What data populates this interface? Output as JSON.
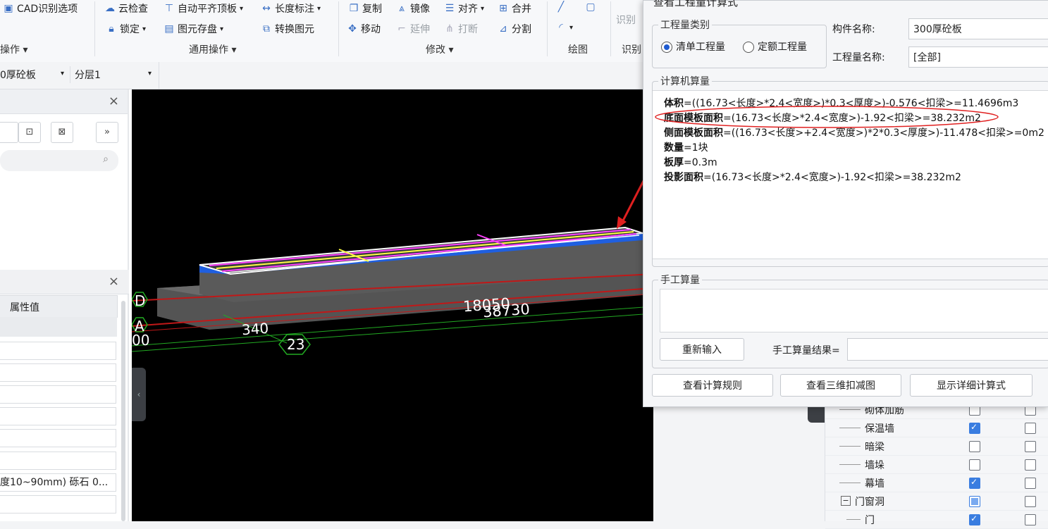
{
  "ribbon": {
    "cad_option": "CAD识别选项",
    "group_ops_partial": "操作",
    "cloud_check": "云检查",
    "auto_flat_top": "自动平齐顶板",
    "length_mark": "长度标注",
    "lock": "锁定",
    "element_save": "图元存盘",
    "convert_element": "转换图元",
    "group_general": "通用操作",
    "copy": "复制",
    "mirror": "镜像",
    "align": "对齐",
    "merge": "合并",
    "move": "移动",
    "extend": "延伸",
    "break": "打断",
    "split": "分割",
    "group_modify": "修改",
    "group_draw": "绘图",
    "identify_partial": "识别",
    "identify_partial2": "识别"
  },
  "subbar": {
    "component_select": "0厚砼板",
    "layer_select": "分层1"
  },
  "leftpanel": {
    "prop_header": "属性值",
    "row_text": "度10~90mm) 砾石 0..."
  },
  "viewport": {
    "dim_18050": "18050",
    "dim_38730": "38730",
    "dim_340": "340",
    "axis_23": "23",
    "axis_d": "D",
    "axis_a": "A",
    "dim_00": "00"
  },
  "dialog": {
    "title": "查看工程量计算式",
    "category_legend": "工程量类别",
    "radio_list": "清单工程量",
    "radio_quota": "定额工程量",
    "component_name_label": "构件名称:",
    "component_name_value": "300厚砼板",
    "quantity_name_label": "工程量名称:",
    "quantity_name_value": "[全部]",
    "computer_legend": "计算机算量",
    "formulas": [
      {
        "name": "体积",
        "expr": "=((16.73<长度>*2.4<宽度>)*0.3<厚度>)-0.576<扣梁>=11.4696m3"
      },
      {
        "name": "底面模板面积",
        "expr": "=(16.73<长度>*2.4<宽度>)-1.92<扣梁>=38.232m2"
      },
      {
        "name": "侧面模板面积",
        "expr": "=((16.73<长度>+2.4<宽度>)*2*0.3<厚度>)-11.478<扣梁>=0m2"
      },
      {
        "name": "数量",
        "expr": "=1块"
      },
      {
        "name": "板厚",
        "expr": "=0.3m"
      },
      {
        "name": "投影面积",
        "expr": "=(16.73<长度>*2.4<宽度>)-1.92<扣梁>=38.232m2"
      }
    ],
    "manual_legend": "手工算量",
    "reinput_button": "重新输入",
    "manual_result_label": "手工算量结果=",
    "rule_button": "查看计算规则",
    "deduct_button": "查看三维扣减图",
    "detail_button": "显示详细计算式"
  },
  "rightpanel": {
    "rows": [
      {
        "label": "砌体加筋"
      },
      {
        "label": "保温墙"
      },
      {
        "label": "暗梁"
      },
      {
        "label": "墙垛"
      },
      {
        "label": "幕墙"
      },
      {
        "label": "门窗洞"
      },
      {
        "label": "门"
      }
    ]
  },
  "colors": {
    "accent": "#3a7de0",
    "slab_top": "#1f5fe0",
    "viewport_bg": "#000000",
    "annotation_red": "#e02020"
  }
}
